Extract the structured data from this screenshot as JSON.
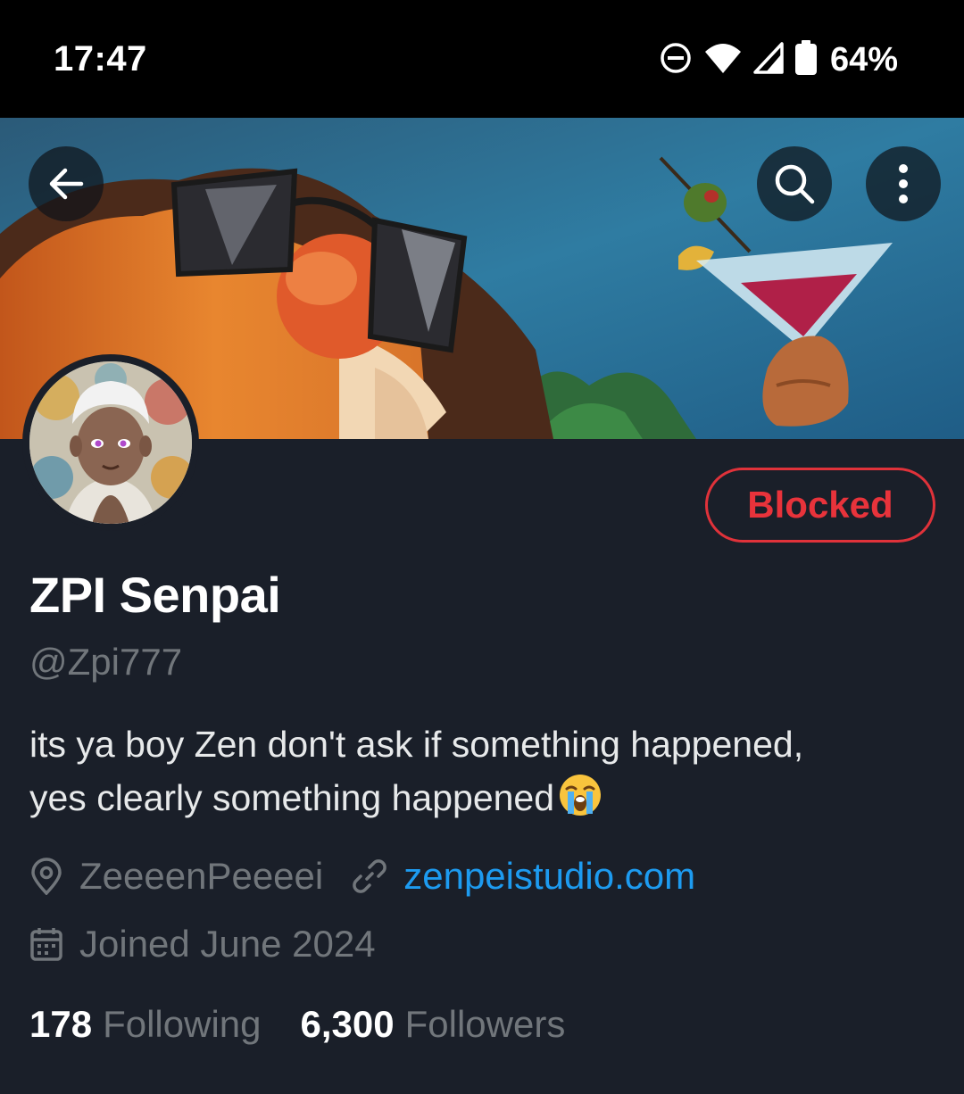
{
  "status_bar": {
    "time": "17:47",
    "battery": "64%",
    "icons": [
      "do-not-disturb-icon",
      "wifi-icon",
      "signal-icon",
      "battery-icon"
    ]
  },
  "header": {
    "icons": [
      "back-arrow-icon",
      "search-icon",
      "more-vertical-icon"
    ]
  },
  "profile": {
    "action_button": "Blocked",
    "display_name": "ZPI Senpai",
    "handle": "@Zpi777",
    "bio_line1": "its ya boy Zen  don't ask if something happened,",
    "bio_line2": "yes clearly something happened",
    "bio_emoji": "loudly-crying-face",
    "location": "ZeeeenPeeeei",
    "website": "zenpeistudio.com",
    "joined": "Joined June 2024",
    "following_count": "178",
    "following_label": "Following",
    "followers_count": "6,300",
    "followers_label": "Followers"
  },
  "colors": {
    "background": "#1a1f29",
    "blocked_red": "#e8333b",
    "link_blue": "#1d9bf0",
    "muted_text": "#71767b"
  }
}
